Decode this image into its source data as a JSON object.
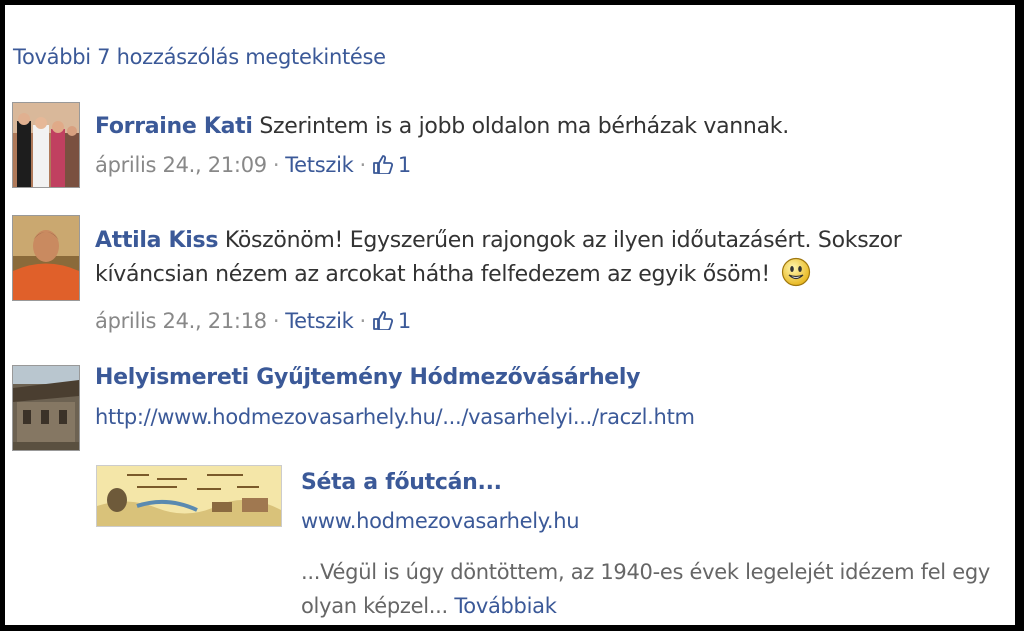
{
  "view_more": "További 7 hozzászólás megtekintése",
  "comments": [
    {
      "author": "Forraine Kati",
      "text": "Szerintem is a jobb oldalon ma bérházak vannak.",
      "time": "április 24., 21:09",
      "like_label": "Tetszik",
      "like_count": "1"
    },
    {
      "author": "Attila Kiss",
      "text": "Köszönöm! Egyszerűen rajongok az ilyen időutazásért. Sokszor kíváncsian nézem az arcokat hátha felfedezem az egyik ősöm!",
      "time": "április 24., 21:18",
      "like_label": "Tetszik",
      "like_count": "1"
    }
  ],
  "shared": {
    "page_name": "Helyismereti Gyűjtemény Hódmezővásárhely",
    "url": "http://www.hodmezovasarhely.hu/.../vasarhelyi.../raczl.htm",
    "preview": {
      "title": "Séta a főutcán...",
      "domain": "www.hodmezovasarhely.hu",
      "description": "...Végül is úgy döntöttem, az 1940-es évek legelejét idézem fel egy olyan képzel...",
      "more_label": "Továbbiak"
    }
  },
  "icons": {
    "like": "thumbs-up-icon",
    "emoticon": "smiley-icon"
  },
  "colors": {
    "link": "#3b5998",
    "text": "#333333",
    "meta": "#888888"
  }
}
